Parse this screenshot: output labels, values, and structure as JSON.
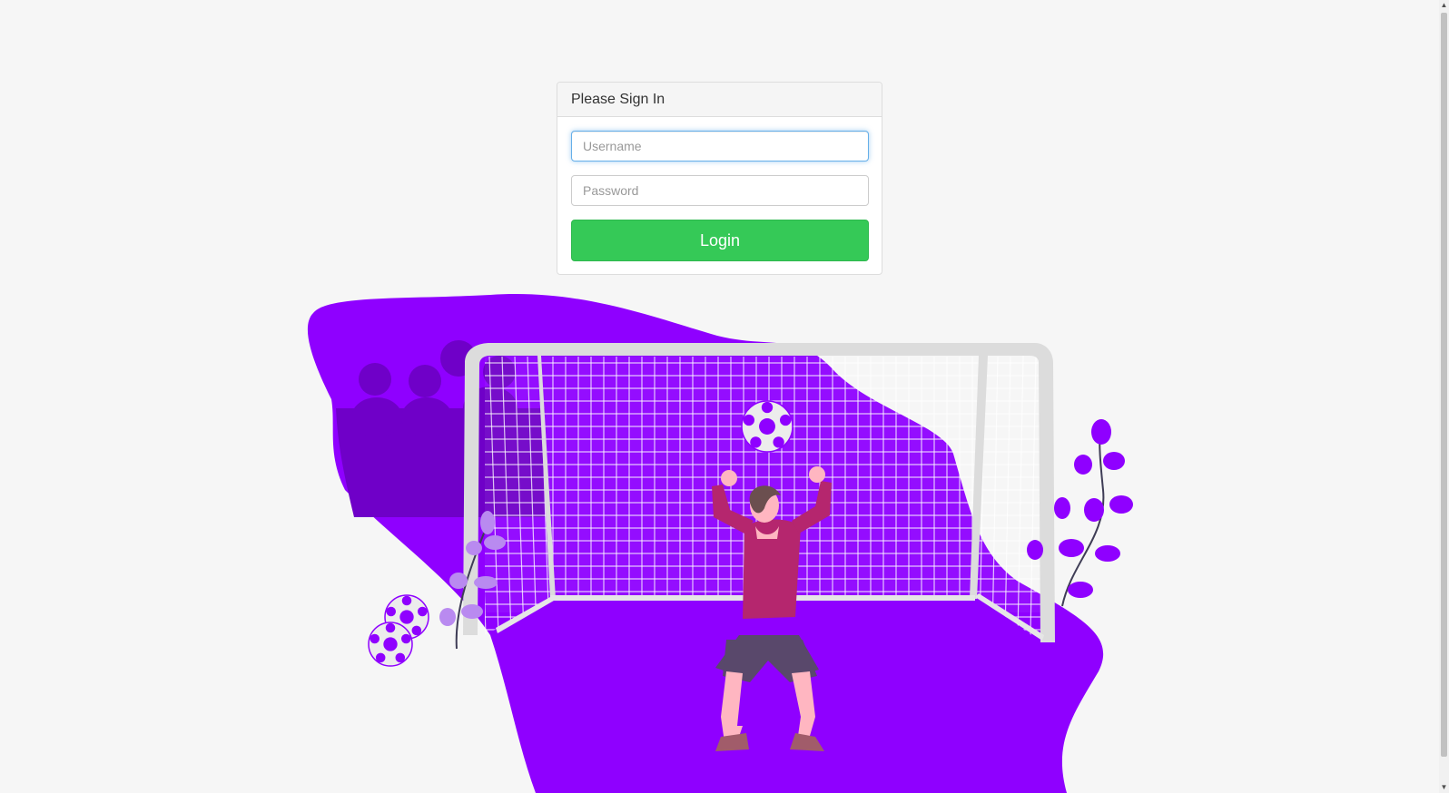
{
  "login": {
    "heading": "Please Sign In",
    "username_placeholder": "Username",
    "username_value": "",
    "password_placeholder": "Password",
    "password_value": "",
    "button_label": "Login"
  },
  "colors": {
    "accent_purple": "#8f00ff",
    "login_green": "#35c957",
    "focus_blue": "#66afe9"
  },
  "illustration": {
    "subject": "goalkeeper-catching-ball-illustration"
  },
  "scrollbar": {
    "up_arrow": "▲",
    "down_arrow": "▼"
  }
}
